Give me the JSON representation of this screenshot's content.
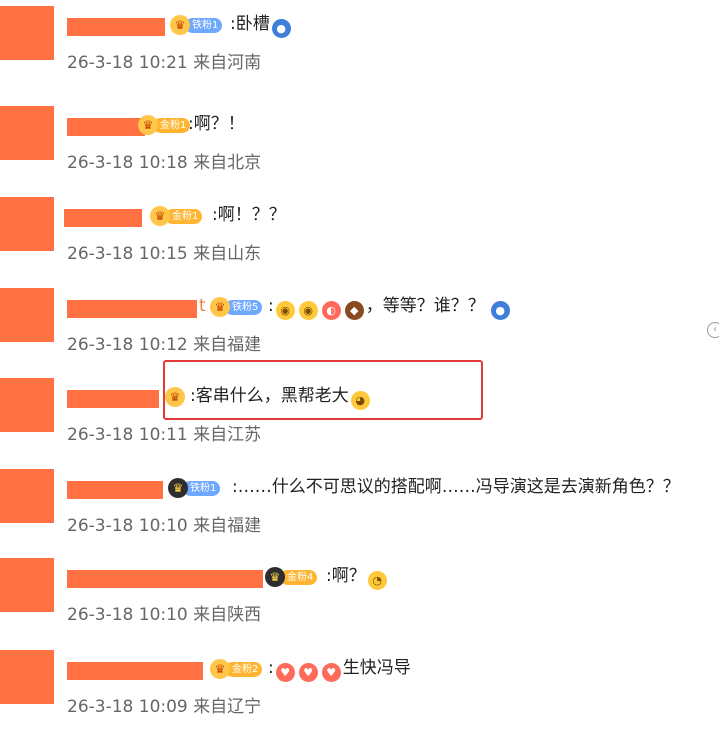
{
  "comments": [
    {
      "badge": {
        "icon": "fan-medal-icon",
        "label": "铁粉1"
      },
      "text": ":卧槽",
      "emojis": [
        "doge-emoji"
      ],
      "timestamp": "26-3-18 10:21",
      "location": "来自河南"
    },
    {
      "badge": {
        "icon": "fan-medal-icon",
        "label": "金粉1"
      },
      "text": ":啊？！",
      "emojis": [],
      "timestamp": "26-3-18 10:18",
      "location": "来自北京"
    },
    {
      "badge": {
        "icon": "fan-medal-icon",
        "label": "金粉1"
      },
      "text": ":啊！？？",
      "emojis": [],
      "timestamp": "26-3-18 10:15",
      "location": "来自山东"
    },
    {
      "badge": {
        "icon": "fan-medal-icon",
        "label": "铁粉5"
      },
      "text_prefix": ":",
      "text": "，等等？谁？？",
      "emojis": [
        "shocked-emoji",
        "shocked-emoji",
        "octopus-emoji",
        "cake-emoji",
        "doge-emoji"
      ],
      "name_suffix": "t",
      "timestamp": "26-3-18 10:12",
      "location": "来自福建"
    },
    {
      "badge": {
        "icon": "fan-medal-icon",
        "label": ""
      },
      "text": ":客串什么，黑帮老大",
      "emojis": [
        "doge-face-emoji"
      ],
      "timestamp": "26-3-18 10:11",
      "location": "来自江苏"
    },
    {
      "badge": {
        "icon": "crown-icon",
        "label": "铁粉1"
      },
      "text": ":……什么不可思议的搭配啊……冯导演这是去演新角色？？",
      "emojis": [],
      "timestamp": "26-3-18 10:10",
      "location": "来自福建"
    },
    {
      "badge": {
        "icon": "crown-icon",
        "label": "金粉4"
      },
      "text": ":啊？",
      "emojis": [
        "crying-emoji"
      ],
      "timestamp": "26-3-18 10:10",
      "location": "来自陕西"
    },
    {
      "badge": {
        "icon": "fan-medal-icon",
        "label": "金粉2"
      },
      "text_prefix": ":",
      "text": "生快冯导",
      "emojis_before": [
        "kiss-emoji",
        "kiss-emoji",
        "kiss-emoji"
      ],
      "timestamp": "26-3-18 10:09",
      "location": "来自辽宁"
    }
  ]
}
